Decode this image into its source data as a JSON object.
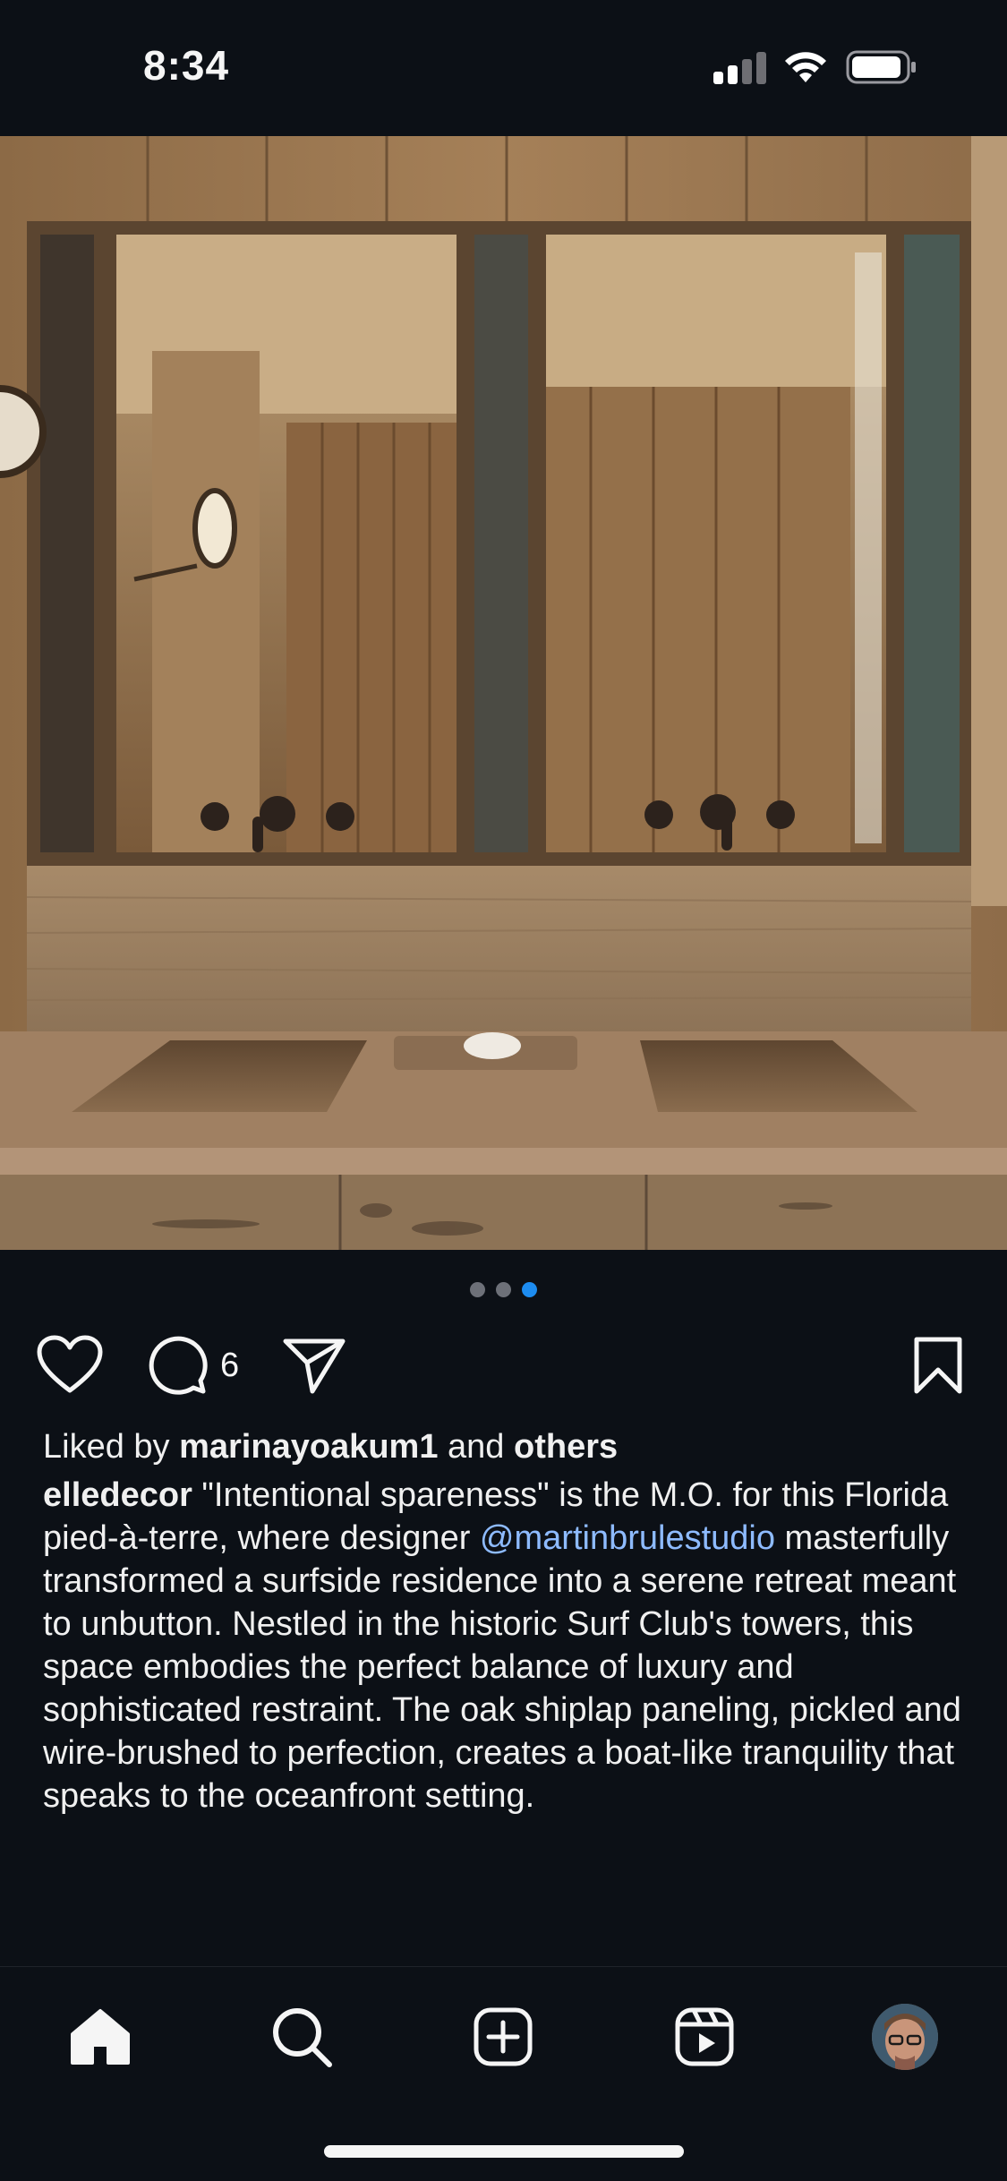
{
  "status_bar": {
    "time": "8:34"
  },
  "photo": {
    "alt_subject": "bathroom-photo",
    "dots": 3,
    "active_dot": 3
  },
  "actions": {
    "comment_count": "6"
  },
  "likes": {
    "prefix": "Liked by ",
    "user": "marinayoakum1",
    "middle": " and ",
    "others": "others"
  },
  "caption": {
    "username": "elledecor",
    "part1": " \"Intentional spareness\" is the M.O. for this Florida pied-à-terre, where designer ",
    "mention": "@martinbrulestudio",
    "part2": " masterfully transformed a surfside residence into a serene retreat meant to unbutton. Nestled in the historic Surf Club's towers, this space embodies the perfect balance of luxury and sophisticated restraint. The oak shiplap paneling, pickled and wire-brushed to perfection, creates a boat-like tranquility that speaks to the oceanfront setting."
  },
  "nav": {
    "items": [
      "home-icon",
      "search-icon",
      "create-icon",
      "reels-icon",
      "profile-avatar"
    ]
  },
  "colors": {
    "background": "#0c1016",
    "accent": "#1d8cf0",
    "mention": "#8ebbff"
  }
}
